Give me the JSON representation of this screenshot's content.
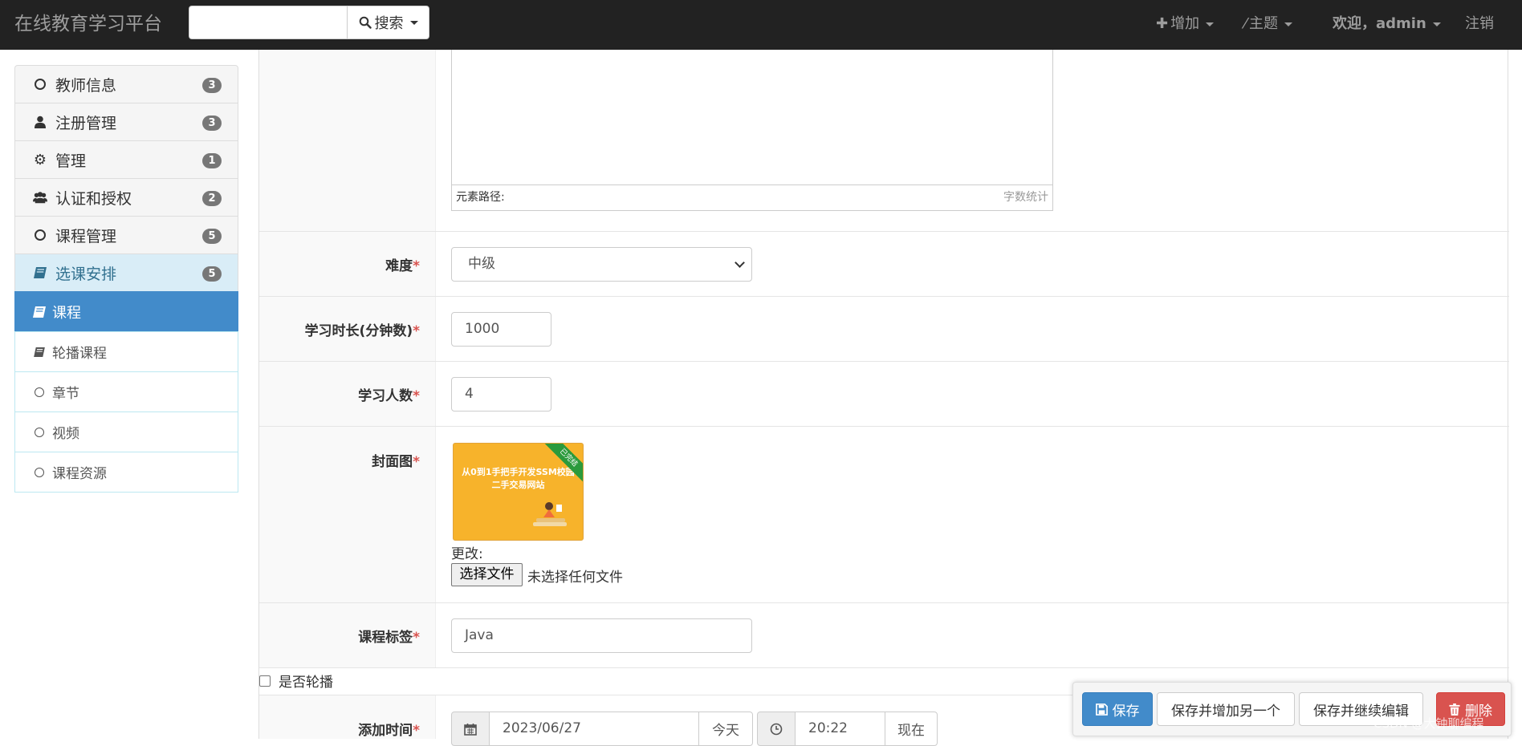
{
  "navbar": {
    "brand": "在线教育学习平台",
    "search_label": "搜索",
    "add_label": "增加",
    "theme_label": "主题",
    "welcome": "欢迎，",
    "username": "admin",
    "logout": "注销"
  },
  "sidebar": {
    "groups": [
      {
        "label": "教师信息",
        "count": "3",
        "icon": "circle-icon"
      },
      {
        "label": "注册管理",
        "count": "3",
        "icon": "user-icon"
      },
      {
        "label": "管理",
        "count": "1",
        "icon": "gear-icon"
      },
      {
        "label": "认证和授权",
        "count": "2",
        "icon": "users-icon"
      },
      {
        "label": "课程管理",
        "count": "5",
        "icon": "circle-icon"
      },
      {
        "label": "选课安排",
        "count": "5",
        "icon": "book-icon"
      }
    ],
    "sub_items": [
      {
        "label": "课程",
        "icon": "book-icon"
      },
      {
        "label": "轮播课程",
        "icon": "book-icon"
      },
      {
        "label": "章节",
        "icon": "circle-icon"
      },
      {
        "label": "视频",
        "icon": "circle-icon"
      },
      {
        "label": "课程资源",
        "icon": "circle-icon"
      }
    ]
  },
  "editor": {
    "path_label": "元素路径:",
    "word_count_label": "字数统计"
  },
  "form": {
    "difficulty": {
      "label": "难度",
      "value": "中级"
    },
    "duration": {
      "label": "学习时长(分钟数)",
      "value": "1000"
    },
    "learners": {
      "label": "学习人数",
      "value": "4"
    },
    "cover": {
      "label": "封面图",
      "image_text_line1": "从0到1手把手开发SSM校园",
      "image_text_line2": "二手交易网站",
      "ribbon": "已完结",
      "change_label": "更改:",
      "file_button": "选择文件",
      "no_file": "未选择任何文件"
    },
    "tags": {
      "label": "课程标签",
      "value": "Java"
    },
    "carousel": {
      "label": "是否轮播"
    },
    "add_time": {
      "label": "添加时间",
      "date": "2023/06/27",
      "today": "今天",
      "time": "20:22",
      "now": "现在"
    },
    "required_mark": "*"
  },
  "actions": {
    "save": "保存",
    "save_add": "保存并增加另一个",
    "save_continue": "保存并继续编辑",
    "delete": "删除"
  },
  "watermark": "CSDN @大钟聊编程"
}
